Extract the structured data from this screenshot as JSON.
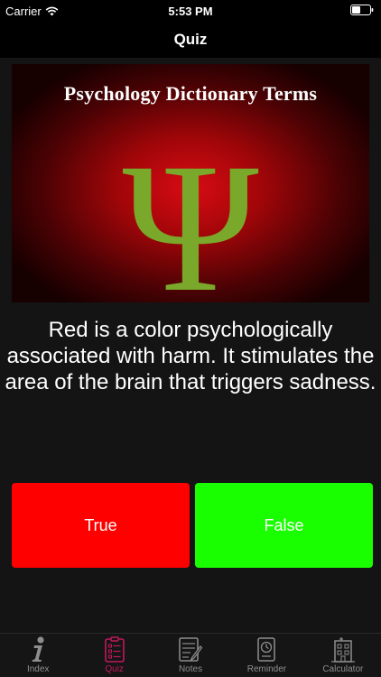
{
  "status_bar": {
    "carrier": "Carrier",
    "time": "5:53 PM",
    "wifi_icon": "wifi-icon",
    "battery_icon": "battery-icon"
  },
  "nav": {
    "title": "Quiz"
  },
  "banner": {
    "title": "Psychology Dictionary Terms",
    "glyph": "Ψ",
    "glyph_color": "#7aa82a"
  },
  "question": {
    "text": "Red is a color psychologically associated with harm. It stimulates the area of the brain that triggers sadness."
  },
  "answers": {
    "true_label": "True",
    "false_label": "False",
    "true_color": "#ff0000",
    "false_color": "#1aff00"
  },
  "tabs": [
    {
      "label": "Index",
      "icon": "info-icon",
      "active": false
    },
    {
      "label": "Quiz",
      "icon": "clipboard-icon",
      "active": true
    },
    {
      "label": "Notes",
      "icon": "notes-icon",
      "active": false
    },
    {
      "label": "Reminder",
      "icon": "reminder-icon",
      "active": false
    },
    {
      "label": "Calculator",
      "icon": "calculator-icon",
      "active": false
    }
  ],
  "colors": {
    "tab_active": "#c2185b",
    "tab_inactive": "#8e8e8e",
    "background": "#000000",
    "panel": "#141414"
  }
}
